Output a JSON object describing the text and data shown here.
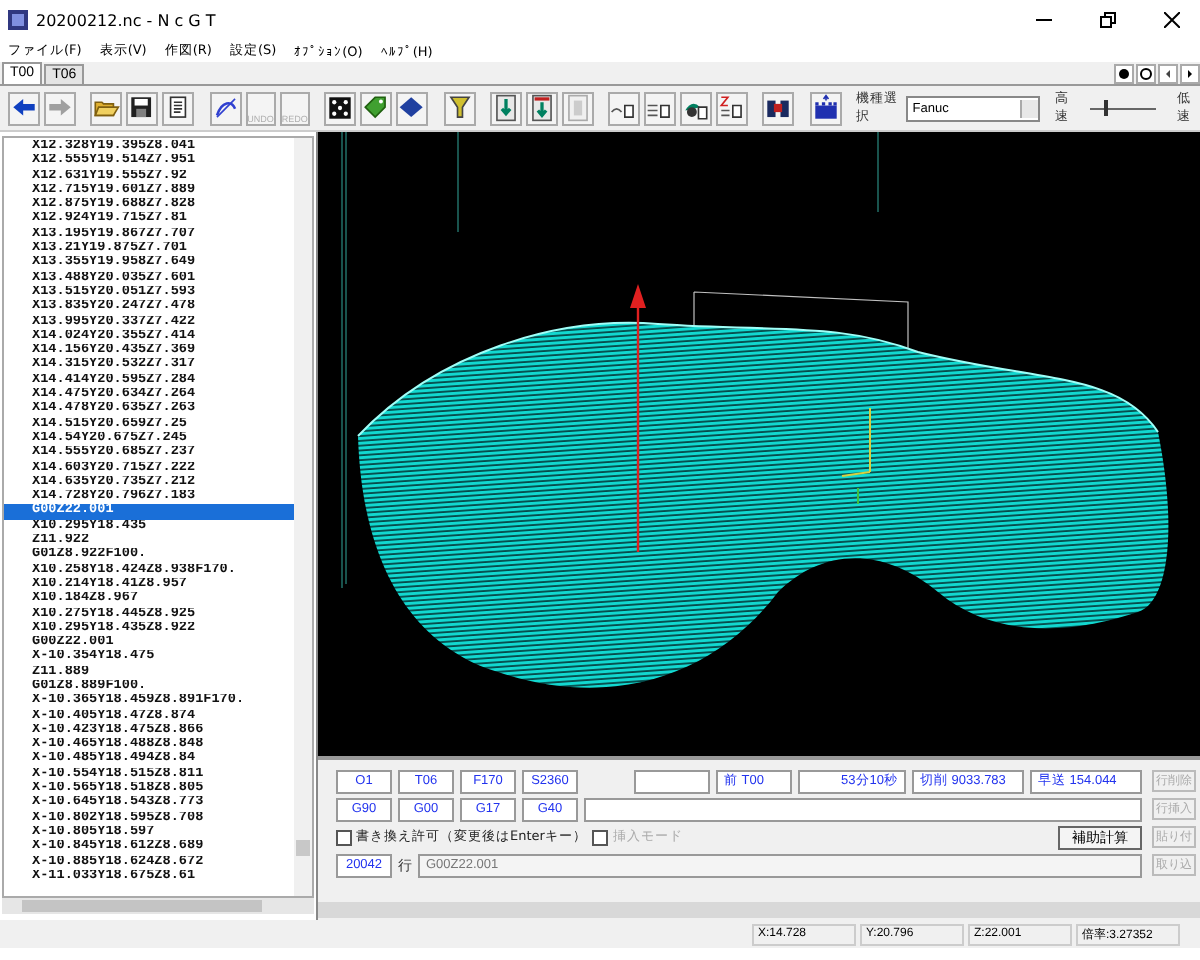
{
  "window": {
    "title": "20200212.nc - N c G T"
  },
  "menu": [
    "ファイル(F)",
    "表示(V)",
    "作図(R)",
    "設定(S)",
    "ｵﾌﾟｼｮﾝ(O)",
    "ﾍﾙﾌﾟ(H)"
  ],
  "tabs": [
    {
      "label": "T00",
      "selected": true
    },
    {
      "label": "T06",
      "selected": false
    }
  ],
  "toolbar": {
    "history_buttons": [
      {
        "label": "UNDO",
        "disabled": true
      },
      {
        "label": "REDO",
        "disabled": true
      }
    ],
    "model_select": {
      "label": "機種選択",
      "value": "Fanuc"
    },
    "speed": {
      "fast_label": "高速",
      "slow_label": "低速",
      "level": 0.2
    }
  },
  "program": {
    "lines": [
      {
        "text": "X12.328Y19.395Z8.041",
        "selected": false
      },
      {
        "text": "X12.555Y19.514Z7.951",
        "selected": false
      },
      {
        "text": "X12.631Y19.555Z7.92",
        "selected": false
      },
      {
        "text": "X12.715Y19.601Z7.889",
        "selected": false
      },
      {
        "text": "X12.875Y19.688Z7.828",
        "selected": false
      },
      {
        "text": "X12.924Y19.715Z7.81",
        "selected": false
      },
      {
        "text": "X13.195Y19.867Z7.707",
        "selected": false
      },
      {
        "text": "X13.21Y19.875Z7.701",
        "selected": false
      },
      {
        "text": "X13.355Y19.958Z7.649",
        "selected": false
      },
      {
        "text": "X13.488Y20.035Z7.601",
        "selected": false
      },
      {
        "text": "X13.515Y20.051Z7.593",
        "selected": false
      },
      {
        "text": "X13.835Y20.247Z7.478",
        "selected": false
      },
      {
        "text": "X13.995Y20.337Z7.422",
        "selected": false
      },
      {
        "text": "X14.024Y20.355Z7.414",
        "selected": false
      },
      {
        "text": "X14.156Y20.435Z7.369",
        "selected": false
      },
      {
        "text": "X14.315Y20.532Z7.317",
        "selected": false
      },
      {
        "text": "X14.414Y20.595Z7.284",
        "selected": false
      },
      {
        "text": "X14.475Y20.634Z7.264",
        "selected": false
      },
      {
        "text": "X14.478Y20.635Z7.263",
        "selected": false
      },
      {
        "text": "X14.515Y20.659Z7.25",
        "selected": false
      },
      {
        "text": "X14.54Y20.675Z7.245",
        "selected": false
      },
      {
        "text": "X14.555Y20.685Z7.237",
        "selected": false
      },
      {
        "text": "X14.603Y20.715Z7.222",
        "selected": false
      },
      {
        "text": "X14.635Y20.735Z7.212",
        "selected": false
      },
      {
        "text": "X14.728Y20.796Z7.183",
        "selected": false
      },
      {
        "text": "G00Z22.001",
        "selected": true
      },
      {
        "text": "X10.295Y18.435",
        "selected": false
      },
      {
        "text": "Z11.922",
        "selected": false
      },
      {
        "text": "G01Z8.922F100.",
        "selected": false
      },
      {
        "text": "X10.258Y18.424Z8.938F170.",
        "selected": false
      },
      {
        "text": "X10.214Y18.41Z8.957",
        "selected": false
      },
      {
        "text": "X10.184Z8.967",
        "selected": false
      },
      {
        "text": "X10.275Y18.445Z8.925",
        "selected": false
      },
      {
        "text": "X10.295Y18.435Z8.922",
        "selected": false
      },
      {
        "text": "G00Z22.001",
        "selected": false
      },
      {
        "text": "X-10.354Y18.475",
        "selected": false
      },
      {
        "text": "Z11.889",
        "selected": false
      },
      {
        "text": "G01Z8.889F100.",
        "selected": false
      },
      {
        "text": "X-10.365Y18.459Z8.891F170.",
        "selected": false
      },
      {
        "text": "X-10.405Y18.47Z8.874",
        "selected": false
      },
      {
        "text": "X-10.423Y18.475Z8.866",
        "selected": false
      },
      {
        "text": "X-10.465Y18.488Z8.848",
        "selected": false
      },
      {
        "text": "X-10.485Y18.494Z8.84",
        "selected": false
      },
      {
        "text": "X-10.554Y18.515Z8.811",
        "selected": false
      },
      {
        "text": "X-10.565Y18.518Z8.805",
        "selected": false
      },
      {
        "text": "X-10.645Y18.543Z8.773",
        "selected": false
      },
      {
        "text": "X-10.802Y18.595Z8.708",
        "selected": false
      },
      {
        "text": "X-10.805Y18.597",
        "selected": false
      },
      {
        "text": "X-10.845Y18.612Z8.689",
        "selected": false
      },
      {
        "text": "X-10.885Y18.624Z8.672",
        "selected": false
      },
      {
        "text": "X-11.033Y18.675Z8.61",
        "selected": false
      }
    ]
  },
  "editor": {
    "modal_row_1": [
      "O1",
      "T06",
      "F170",
      "S2360"
    ],
    "modal_row_2": [
      "G90",
      "G00",
      "G17",
      "G40"
    ],
    "previous_tool": "前 T00",
    "time": "53分10秒",
    "cutting": "切削 9033.783",
    "rapid": "早送 154.044",
    "overwrite": {
      "label": "書き換え許可（変更後はEnterキー）",
      "checked": false,
      "disabled": false
    },
    "insert_mode": {
      "label": "挿入モード",
      "checked": false,
      "disabled": true
    },
    "calc_button": "補助計算",
    "line": {
      "number": "20042",
      "unit": "行",
      "value": "G00Z22.001"
    },
    "side_buttons": [
      {
        "label": "行削除",
        "disabled": true
      },
      {
        "label": "行挿入",
        "disabled": true
      },
      {
        "label": "貼り付",
        "disabled": true
      },
      {
        "label": "取り込",
        "disabled": true
      }
    ]
  },
  "status_bar": [
    "X:14.728",
    "Y:20.796",
    "Z:22.001",
    "倍率:3.27352"
  ]
}
